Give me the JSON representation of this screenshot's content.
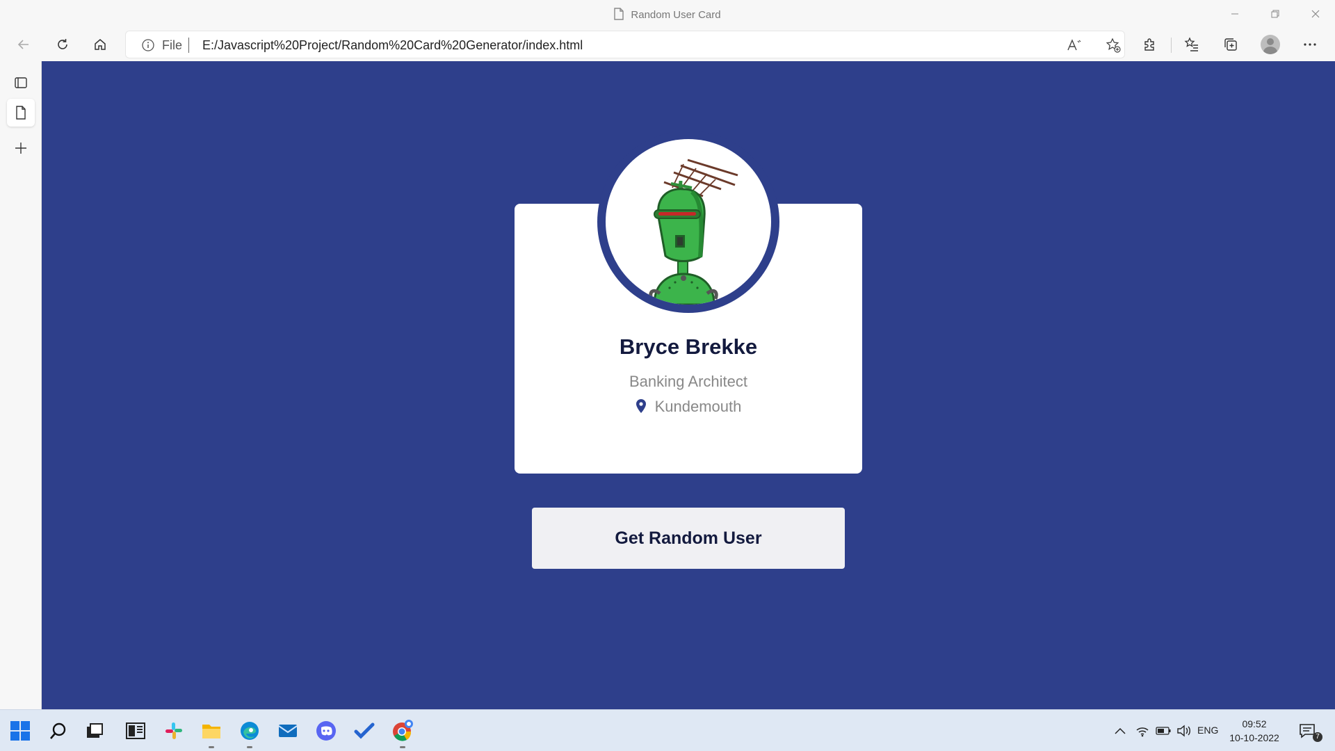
{
  "window": {
    "title": "Random User Card"
  },
  "addressbar": {
    "scheme_label": "File",
    "url": "E:/Javascript%20Project/Random%20Card%20Generator/index.html"
  },
  "profile_card": {
    "name": "Bryce Brekke",
    "job_title": "Banking Architect",
    "location": "Kundemouth"
  },
  "action": {
    "button_label": "Get Random User"
  },
  "colors": {
    "page_background": "#2e3f8b",
    "card_background": "#ffffff",
    "name_text": "#131a3e",
    "muted_text": "#888888"
  },
  "taskbar": {
    "apps": [
      "start",
      "search",
      "task-view",
      "widgets",
      "slack",
      "file-explorer",
      "edge",
      "mail",
      "discord",
      "todo",
      "chrome"
    ],
    "language": "ENG",
    "time": "09:52",
    "date": "10-10-2022",
    "notification_count": "7"
  }
}
